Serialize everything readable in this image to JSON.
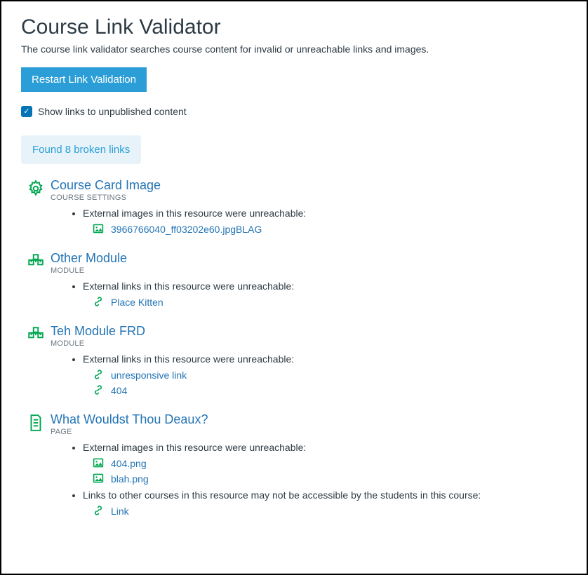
{
  "header": {
    "title": "Course Link Validator",
    "description": "The course link validator searches course content for invalid or unreachable links and images.",
    "restartLabel": "Restart Link Validation",
    "checkboxLabel": "Show links to unpublished content"
  },
  "summary": "Found 8 broken links",
  "issueTexts": {
    "externalImages": "External images in this resource were unreachable:",
    "externalLinks": "External links in this resource were unreachable:",
    "crossCourseLinks": "Links to other courses in this resource may not be accessible by the students in this course:"
  },
  "results": [
    {
      "id": "course-card-image",
      "icon": "gear",
      "title": "Course Card Image",
      "subtitle": "Course Settings",
      "issues": [
        {
          "textKey": "externalImages",
          "links": [
            {
              "icon": "image",
              "label": "3966766040_ff03202e60.jpgBLAG"
            }
          ]
        }
      ]
    },
    {
      "id": "other-module",
      "icon": "module",
      "title": "Other Module",
      "subtitle": "Module",
      "issues": [
        {
          "textKey": "externalLinks",
          "links": [
            {
              "icon": "link",
              "label": "Place Kitten"
            }
          ]
        }
      ]
    },
    {
      "id": "teh-module-frd",
      "icon": "module",
      "title": "Teh Module FRD",
      "subtitle": "Module",
      "issues": [
        {
          "textKey": "externalLinks",
          "links": [
            {
              "icon": "link",
              "label": "unresponsive link"
            },
            {
              "icon": "link",
              "label": "404"
            }
          ]
        }
      ]
    },
    {
      "id": "what-wouldst-thou-deaux",
      "icon": "page",
      "title": "What Wouldst Thou Deaux?",
      "subtitle": "Page",
      "issues": [
        {
          "textKey": "externalImages",
          "links": [
            {
              "icon": "image",
              "label": "404.png"
            },
            {
              "icon": "image",
              "label": "blah.png"
            }
          ]
        },
        {
          "textKey": "crossCourseLinks",
          "links": [
            {
              "icon": "link",
              "label": "Link"
            }
          ]
        }
      ]
    }
  ]
}
